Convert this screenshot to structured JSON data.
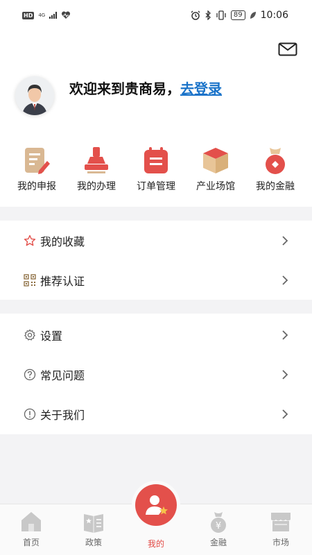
{
  "status_bar": {
    "hd": "HD",
    "network": "4G",
    "battery": "89",
    "time": "10:06"
  },
  "header": {
    "mail_icon": "mail-icon"
  },
  "profile": {
    "welcome_text": "欢迎来到贵商易，",
    "login_link": "去登录",
    "avatar_icon": "user-avatar"
  },
  "quick_actions": [
    {
      "label": "我的申报",
      "icon": "declare-icon"
    },
    {
      "label": "我的办理",
      "icon": "stamp-icon"
    },
    {
      "label": "订单管理",
      "icon": "calendar-icon"
    },
    {
      "label": "产业场馆",
      "icon": "box-icon"
    },
    {
      "label": "我的金融",
      "icon": "money-bag-icon"
    }
  ],
  "menu_group_1": [
    {
      "label": "我的收藏",
      "icon": "star-icon"
    },
    {
      "label": "推荐认证",
      "icon": "qr-icon"
    }
  ],
  "menu_group_2": [
    {
      "label": "设置",
      "icon": "gear-icon"
    },
    {
      "label": "常见问题",
      "icon": "question-icon"
    },
    {
      "label": "关于我们",
      "icon": "info-icon"
    }
  ],
  "tabbar": [
    {
      "label": "首页",
      "icon": "home-icon"
    },
    {
      "label": "政策",
      "icon": "policy-icon"
    },
    {
      "label": "我的",
      "icon": "profile-icon"
    },
    {
      "label": "金融",
      "icon": "finance-icon"
    },
    {
      "label": "市场",
      "icon": "market-icon"
    }
  ],
  "colors": {
    "accent": "#e3504b",
    "link": "#1a73c9",
    "band": "#f3f3f5"
  }
}
